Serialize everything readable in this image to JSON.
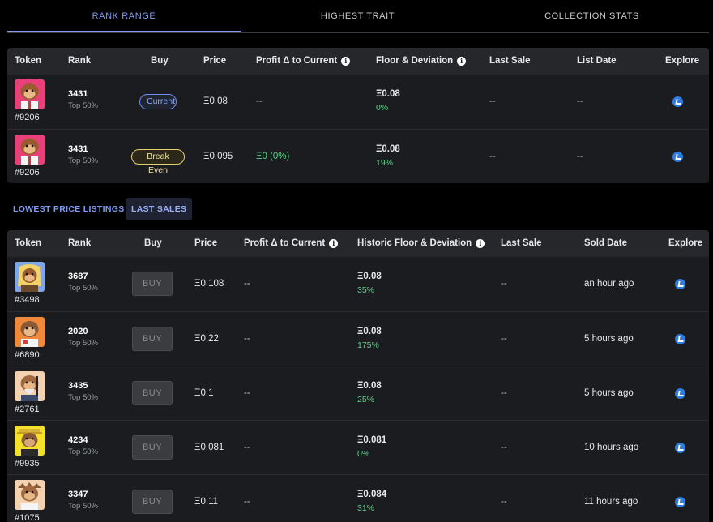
{
  "tabs": [
    {
      "label": "RANK RANGE",
      "active": true
    },
    {
      "label": "HIGHEST TRAIT",
      "active": false
    },
    {
      "label": "COLLECTION STATS",
      "active": false
    }
  ],
  "top_table": {
    "columns": [
      "Token",
      "Rank",
      "Buy",
      "Price",
      "Profit Δ to Current",
      "Floor & Deviation",
      "Last Sale",
      "List Date",
      "Explore"
    ],
    "rows": [
      {
        "token": "#9206",
        "rank": "3431",
        "rank_sub": "Top 50%",
        "buy": "Current",
        "price": "Ξ0.08",
        "profit": "--",
        "floor": "Ξ0.08",
        "deviation": "0%",
        "last_sale": "--",
        "list_date": "--"
      },
      {
        "token": "#9206",
        "rank": "3431",
        "rank_sub": "Top 50%",
        "buy": "Break Even",
        "price": "Ξ0.095",
        "profit": "Ξ0 (0%)",
        "floor": "Ξ0.08",
        "deviation": "19%",
        "last_sale": "--",
        "list_date": "--"
      }
    ]
  },
  "subtabs": [
    {
      "label": "LOWEST PRICE LISTINGS",
      "active": false
    },
    {
      "label": "LAST SALES",
      "active": true
    }
  ],
  "bottom_table": {
    "columns": [
      "Token",
      "Rank",
      "Buy",
      "Price",
      "Profit Δ to Current",
      "Historic Floor & Deviation",
      "Last Sale",
      "Sold Date",
      "Explore"
    ],
    "rows": [
      {
        "token": "#3498",
        "rank": "3687",
        "rank_sub": "Top 50%",
        "buy": "BUY",
        "price": "Ξ0.108",
        "profit": "--",
        "floor": "Ξ0.08",
        "deviation": "35%",
        "last_sale": "--",
        "sold_date": "an hour ago"
      },
      {
        "token": "#6890",
        "rank": "2020",
        "rank_sub": "Top 50%",
        "buy": "BUY",
        "price": "Ξ0.22",
        "profit": "--",
        "floor": "Ξ0.08",
        "deviation": "175%",
        "last_sale": "--",
        "sold_date": "5 hours ago"
      },
      {
        "token": "#2761",
        "rank": "3435",
        "rank_sub": "Top 50%",
        "buy": "BUY",
        "price": "Ξ0.1",
        "profit": "--",
        "floor": "Ξ0.08",
        "deviation": "25%",
        "last_sale": "--",
        "sold_date": "5 hours ago"
      },
      {
        "token": "#9935",
        "rank": "4234",
        "rank_sub": "Top 50%",
        "buy": "BUY",
        "price": "Ξ0.081",
        "profit": "--",
        "floor": "Ξ0.081",
        "deviation": "0%",
        "last_sale": "--",
        "sold_date": "10 hours ago"
      },
      {
        "token": "#1075",
        "rank": "3347",
        "rank_sub": "Top 50%",
        "buy": "BUY",
        "price": "Ξ0.11",
        "profit": "--",
        "floor": "Ξ0.084",
        "deviation": "31%",
        "last_sale": "--",
        "sold_date": "11 hours ago"
      }
    ]
  },
  "colors": {
    "accent": "#7f9cf2",
    "positive": "#5fcf8a",
    "explore": "#2f7de1",
    "current_pill": "#6d8ef0",
    "breakeven_pill": "#e6cf6d"
  },
  "icons": {
    "info": "info-icon",
    "explore": "opensea-icon"
  }
}
